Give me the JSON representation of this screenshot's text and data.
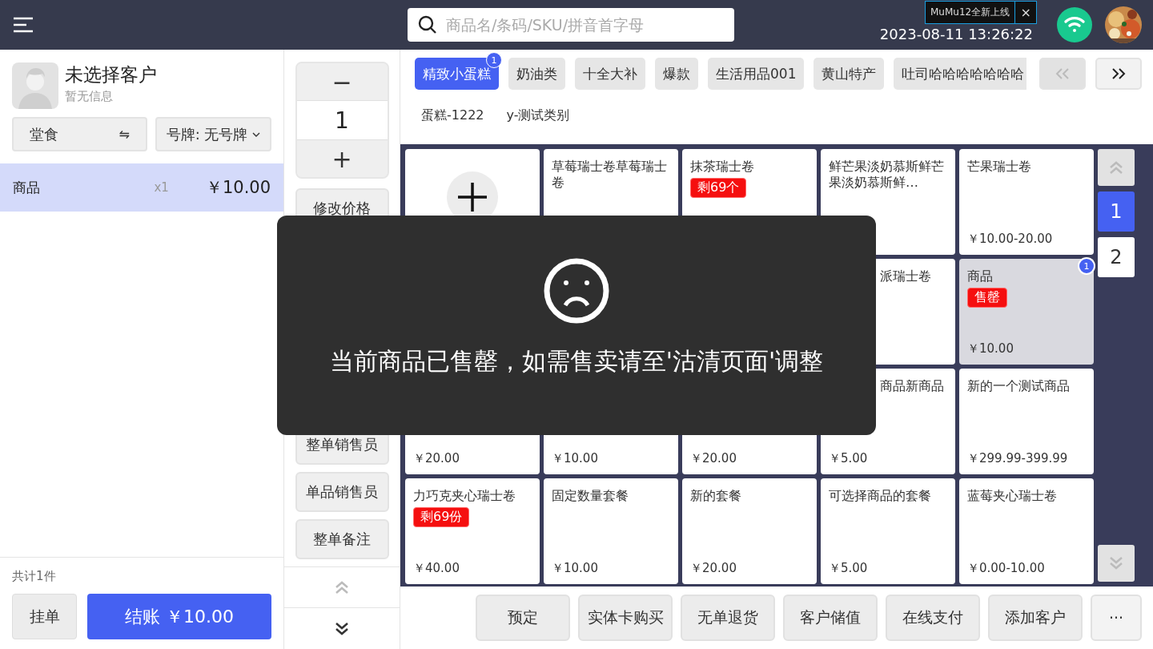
{
  "top_bar": {
    "search": {
      "placeholder": "商品名/条码/SKU/拼音首字母"
    },
    "datetime": "2023-08-11 13:26:22",
    "tooltip": {
      "text": "MuMu12全新上线",
      "close": "×"
    }
  },
  "customer": {
    "name": "未选择客户",
    "info": "暂无信息"
  },
  "order_type": {
    "label": "堂食",
    "icon": "⇋"
  },
  "number_plate": {
    "label": "号牌: 无号牌"
  },
  "cart_items": [
    {
      "name": "商品",
      "qty": "x1",
      "price": "￥10.00",
      "selected": true
    }
  ],
  "cart_footer": {
    "total": "共计1件",
    "hold": "挂单",
    "checkout": "结账 ￥10.00"
  },
  "stepper": {
    "minus": "−",
    "value": "1",
    "plus": "+"
  },
  "actions_top": [
    "修改价格"
  ],
  "actions_bottom": [
    "整单销售员",
    "单品销售员",
    "整单备注"
  ],
  "categories": [
    {
      "label": "精致小蛋糕",
      "selected": true,
      "count": "1"
    },
    {
      "label": "奶油类",
      "selected": false
    },
    {
      "label": "十全大补",
      "selected": false
    },
    {
      "label": "爆款",
      "selected": false
    },
    {
      "label": "生活用品001",
      "selected": false
    },
    {
      "label": "黄山特产",
      "selected": false
    },
    {
      "label": "吐司哈哈哈哈哈哈哈",
      "selected": false
    }
  ],
  "subcategories": [
    {
      "label": "蛋糕-1222"
    },
    {
      "label": "y-测试类别"
    }
  ],
  "products": [
    {
      "kind": "temp"
    },
    {
      "kind": "item",
      "name": "草莓瑞士卷草莓瑞士卷",
      "sold_out": false
    },
    {
      "kind": "item",
      "name": "抹茶瑞士卷",
      "tag": "剩69个",
      "sold_out": false
    },
    {
      "kind": "item",
      "name": "鲜芒果淡奶慕斯鲜芒果淡奶慕斯鲜…",
      "sold_out": false
    },
    {
      "kind": "item",
      "name": "芒果瑞士卷",
      "price": "￥10.00-20.00",
      "sold_out": false
    },
    {
      "kind": "covered"
    },
    {
      "kind": "covered"
    },
    {
      "kind": "covered"
    },
    {
      "kind": "clipped",
      "name": "派瑞士卷",
      "sold_out": false
    },
    {
      "kind": "item",
      "name": "商品",
      "tag": "售罄",
      "price": "￥10.00",
      "sold_out": true,
      "count": "1"
    },
    {
      "kind": "item",
      "price": "￥20.00",
      "sold_out": false
    },
    {
      "kind": "item",
      "price": "￥10.00",
      "sold_out": false
    },
    {
      "kind": "item",
      "price": "￥20.00",
      "sold_out": false
    },
    {
      "kind": "clipped",
      "name": "商品新商品",
      "price": "￥5.00",
      "sold_out": false
    },
    {
      "kind": "item",
      "name": "新的一个测试商品",
      "price": "￥299.99-399.99",
      "sold_out": false
    },
    {
      "kind": "item",
      "name": "力巧克夹心瑞士卷",
      "tag": "剩69份",
      "price": "￥40.00",
      "sold_out": false
    },
    {
      "kind": "item",
      "name": "固定数量套餐",
      "price": "￥10.00",
      "sold_out": false
    },
    {
      "kind": "item",
      "name": "新的套餐",
      "price": "￥20.00",
      "sold_out": false
    },
    {
      "kind": "item",
      "name": "可选择商品的套餐",
      "price": "￥5.00",
      "sold_out": false
    },
    {
      "kind": "item",
      "name": "蓝莓夹心瑞士卷",
      "price": "￥0.00-10.00",
      "sold_out": false
    }
  ],
  "pages": [
    {
      "label": "1",
      "selected": true
    },
    {
      "label": "2",
      "selected": false
    }
  ],
  "bottom_actions": [
    "预定",
    "实体卡购买",
    "无单退货",
    "客户储值",
    "在线支付",
    "添加客户",
    "···"
  ],
  "toast": {
    "message": "当前商品已售罄，如需售卖请至'沽清页面'调整"
  }
}
